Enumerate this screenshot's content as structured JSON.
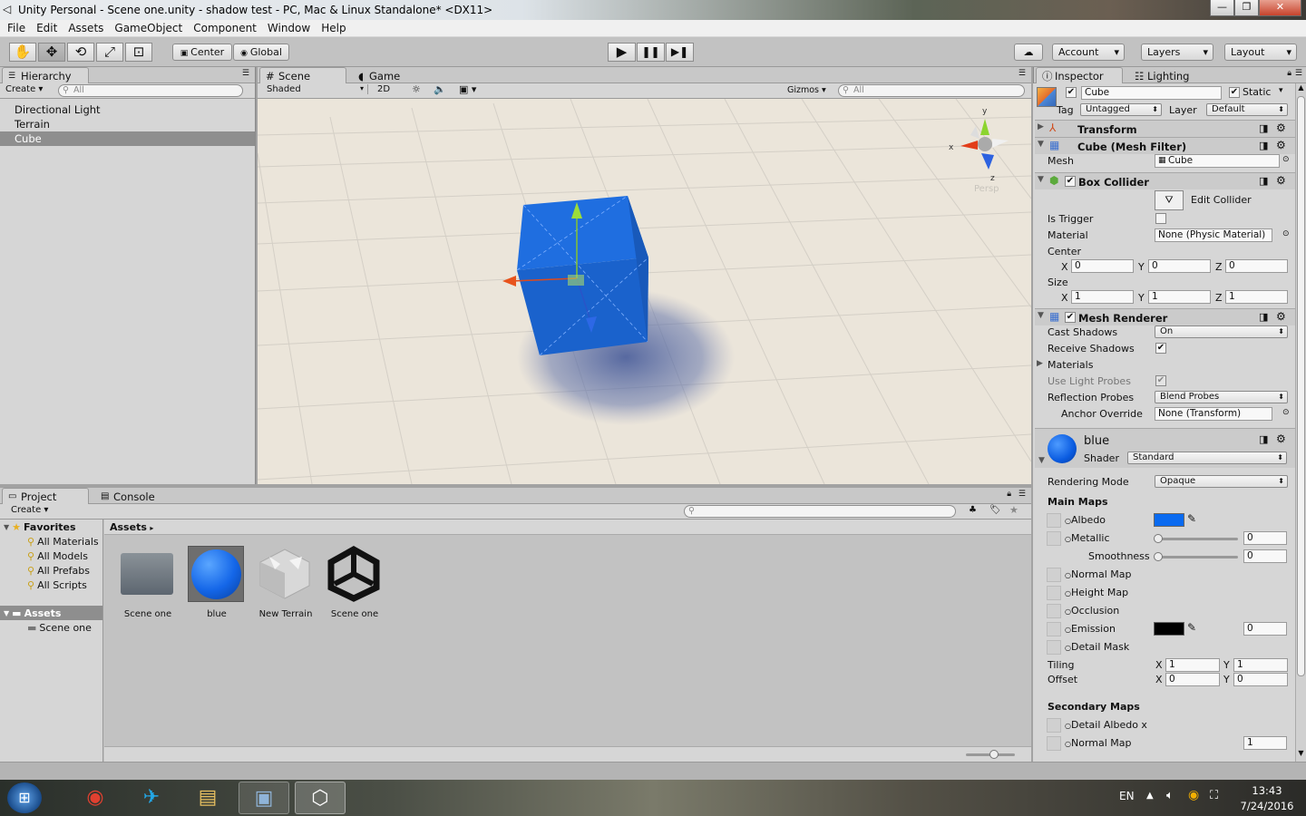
{
  "window": {
    "title": "Unity Personal - Scene one.unity - shadow test - PC, Mac & Linux Standalone* <DX11>",
    "buttons": [
      "—",
      "❐",
      "✕"
    ]
  },
  "menu": [
    "File",
    "Edit",
    "Assets",
    "GameObject",
    "Component",
    "Window",
    "Help"
  ],
  "toolbar": {
    "pivot": "Center",
    "space": "Global",
    "account": "Account",
    "layers": "Layers",
    "layout": "Layout"
  },
  "hierarchy": {
    "tab": "Hierarchy",
    "create": "Create",
    "search": "All",
    "items": [
      "Directional Light",
      "Terrain",
      "Cube"
    ],
    "selected": "Cube"
  },
  "scene": {
    "tab_scene": "Scene",
    "tab_game": "Game",
    "shading": "Shaded",
    "mode2d": "2D",
    "gizmos": "Gizmos",
    "search": "All",
    "persp": "Persp",
    "gizmo_y": "y",
    "gizmo_x": "x",
    "gizmo_z": "z"
  },
  "project": {
    "tab_project": "Project",
    "tab_console": "Console",
    "create": "Create",
    "favorites": "Favorites",
    "fav_items": [
      "All Materials",
      "All Models",
      "All Prefabs",
      "All Scripts"
    ],
    "assets": "Assets",
    "assets_children": [
      "Scene one"
    ],
    "breadcrumb": "Assets",
    "grid": [
      {
        "name": "Scene one",
        "kind": "folder"
      },
      {
        "name": "blue",
        "kind": "material"
      },
      {
        "name": "New Terrain",
        "kind": "terrain"
      },
      {
        "name": "Scene one",
        "kind": "unity"
      }
    ]
  },
  "inspector": {
    "tab": "Inspector",
    "tab_lighting": "Lighting",
    "object_name": "Cube",
    "static": "Static",
    "tag_label": "Tag",
    "tag": "Untagged",
    "layer_label": "Layer",
    "layer": "Default",
    "transform": "Transform",
    "mesh_filter": "Cube (Mesh Filter)",
    "mesh_label": "Mesh",
    "mesh": "Cube",
    "box_collider": "Box Collider",
    "edit_collider": "Edit Collider",
    "is_trigger": "Is Trigger",
    "material_label": "Material",
    "material": "None (Physic Material)",
    "center_label": "Center",
    "center": {
      "x": "0",
      "y": "0",
      "z": "0"
    },
    "size_label": "Size",
    "size": {
      "x": "1",
      "y": "1",
      "z": "1"
    },
    "axis_x": "X",
    "axis_y": "Y",
    "axis_z": "Z",
    "mesh_renderer": "Mesh Renderer",
    "cast_shadows": "Cast Shadows",
    "cast_shadows_value": "On",
    "receive_shadows": "Receive Shadows",
    "materials": "Materials",
    "use_light_probes": "Use Light Probes",
    "reflection_probes": "Reflection Probes",
    "reflection_probes_value": "Blend Probes",
    "anchor_override": "Anchor Override",
    "anchor_override_value": "None (Transform)",
    "mat_name": "blue",
    "shader_label": "Shader",
    "shader": "Standard",
    "rendering_mode": "Rendering Mode",
    "rendering_mode_value": "Opaque",
    "main_maps": "Main Maps",
    "albedo": "Albedo",
    "metallic": "Metallic",
    "metallic_value": "0",
    "smoothness": "Smoothness",
    "smoothness_value": "0",
    "normal_map": "Normal Map",
    "height_map": "Height Map",
    "occlusion": "Occlusion",
    "emission": "Emission",
    "emission_value": "0",
    "detail_mask": "Detail Mask",
    "tiling": "Tiling",
    "tiling_x": "1",
    "tiling_y": "1",
    "offset": "Offset",
    "offset_x": "0",
    "offset_y": "0",
    "secondary_maps": "Secondary Maps",
    "detail_albedo": "Detail Albedo x",
    "normal_map2": "Normal Map",
    "normal_map2_value": "1"
  },
  "colors": {
    "albedo": "#0a6af0",
    "emission": "#000000",
    "cube": "#1a66d6"
  },
  "taskbar": {
    "lang": "EN",
    "time": "13:43",
    "date": "7/24/2016"
  }
}
